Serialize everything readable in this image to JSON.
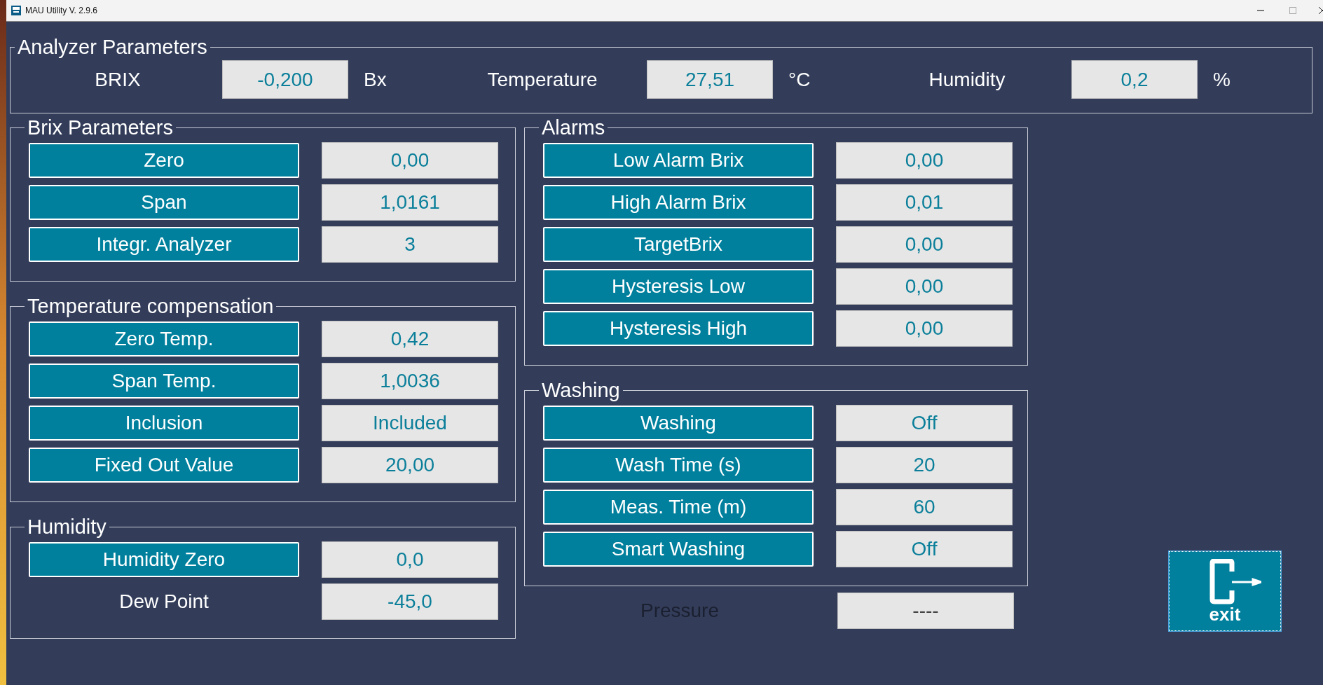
{
  "window": {
    "title": "MAU Utility V. 2.9.6"
  },
  "analyzer_parameters": {
    "title": "Analyzer Parameters",
    "readings": [
      {
        "label": "BRIX",
        "value": "-0,200",
        "unit": "Bx"
      },
      {
        "label": "Temperature",
        "value": "27,51",
        "unit": "°C"
      },
      {
        "label": "Humidity",
        "value": "0,2",
        "unit": "%"
      }
    ]
  },
  "left_column": [
    {
      "title": "Brix Parameters",
      "rows": [
        {
          "kind": "button",
          "label": "Zero",
          "value": "0,00"
        },
        {
          "kind": "button",
          "label": "Span",
          "value": "1,0161"
        },
        {
          "kind": "button",
          "label": "Integr. Analyzer",
          "value": "3"
        }
      ]
    },
    {
      "title": "Temperature compensation",
      "rows": [
        {
          "kind": "button",
          "label": "Zero Temp.",
          "value": "0,42"
        },
        {
          "kind": "button",
          "label": "Span Temp.",
          "value": "1,0036"
        },
        {
          "kind": "button",
          "label": "Inclusion",
          "value": "Included"
        },
        {
          "kind": "button",
          "label": "Fixed Out Value",
          "value": "20,00"
        }
      ]
    },
    {
      "title": "Humidity",
      "rows": [
        {
          "kind": "button",
          "label": "Humidity Zero",
          "value": "0,0"
        },
        {
          "kind": "label",
          "label": "Dew Point",
          "value": "-45,0"
        }
      ]
    }
  ],
  "right_column": [
    {
      "title": "Alarms",
      "rows": [
        {
          "kind": "button",
          "label": "Low Alarm Brix",
          "value": "0,00"
        },
        {
          "kind": "button",
          "label": "High Alarm Brix",
          "value": "0,01"
        },
        {
          "kind": "button",
          "label": "TargetBrix",
          "value": "0,00"
        },
        {
          "kind": "button",
          "label": "Hysteresis Low",
          "value": "0,00"
        },
        {
          "kind": "button",
          "label": "Hysteresis High",
          "value": "0,00"
        }
      ]
    },
    {
      "title": "Washing",
      "rows": [
        {
          "kind": "button",
          "label": "Washing",
          "value": "Off"
        },
        {
          "kind": "button",
          "label": "Wash Time (s)",
          "value": "20"
        },
        {
          "kind": "button",
          "label": "Meas. Time (m)",
          "value": "60"
        },
        {
          "kind": "button",
          "label": "Smart Washing",
          "value": "Off"
        }
      ]
    }
  ],
  "pressure": {
    "label": "Pressure",
    "value": "----",
    "disabled": true
  },
  "exit_button": {
    "label": "exit"
  }
}
